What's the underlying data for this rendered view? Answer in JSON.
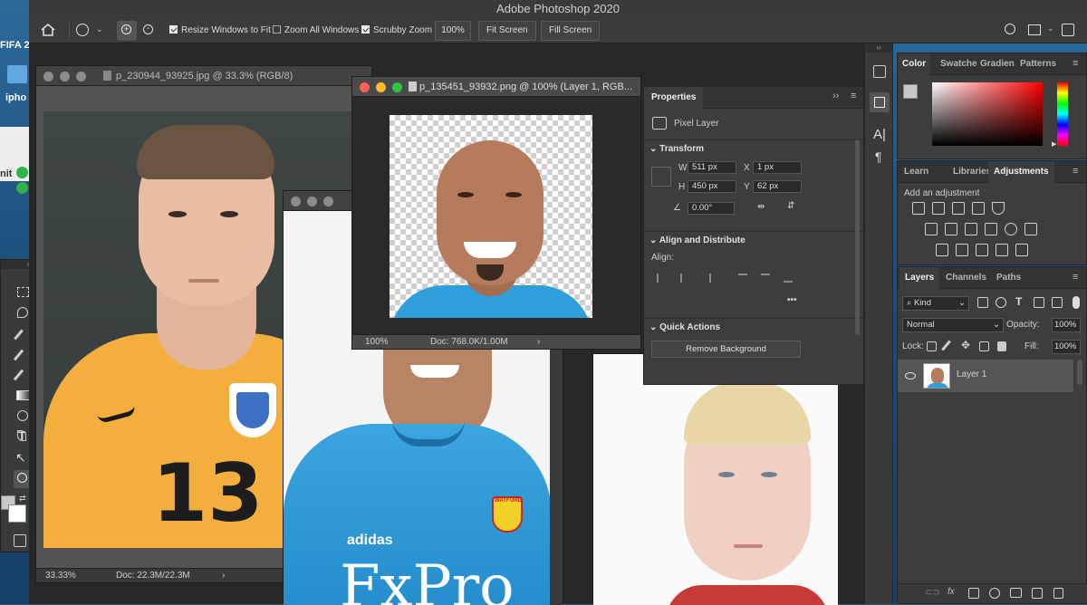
{
  "app": {
    "title": "Adobe Photoshop 2020"
  },
  "desktop": {
    "icons": [
      {
        "label": "FIFA 2"
      },
      {
        "label": "ipho"
      },
      {
        "label": "nit"
      }
    ]
  },
  "options": {
    "resize_label": "Resize Windows to Fit",
    "zoom_all_label": "Zoom All Windows",
    "scrubby_label": "Scrubby Zoom",
    "zoom_value": "100%",
    "fit_screen": "Fit Screen",
    "fill_screen": "Fill Screen"
  },
  "docs": {
    "doc1": {
      "title": "p_230944_93925.jpg @ 33.3% (RGB/8)",
      "zoom": "33.33%",
      "info": "Doc: 22.3M/22.3M",
      "arrow": "›",
      "jersey_number": "13"
    },
    "doc2": {
      "title": "p_135451_93932.png @ 100% (Layer 1, RGB...",
      "zoom": "100%",
      "info": "Doc: 768.0K/1.00M",
      "arrow": "›"
    },
    "doc3": {
      "brand": "adidas",
      "sponsor": "FxPro",
      "crest": "WATFORD"
    }
  },
  "properties": {
    "title": "Properties",
    "layer_type": "Pixel Layer",
    "transform": {
      "title": "Transform",
      "w_label": "W",
      "w": "511 px",
      "x_label": "X",
      "x": "1 px",
      "h_label": "H",
      "h": "450 px",
      "y_label": "Y",
      "y": "62 px",
      "angle": "0.00°"
    },
    "align": {
      "title": "Align and Distribute",
      "label": "Align:"
    },
    "quick": {
      "title": "Quick Actions",
      "remove_bg": "Remove Background"
    }
  },
  "color_panel": {
    "tabs": [
      "Color",
      "Swatche",
      "Gradien",
      "Patterns"
    ]
  },
  "adjust_panel": {
    "tabs": [
      "Learn",
      "Libraries",
      "Adjustments"
    ],
    "add_label": "Add an adjustment"
  },
  "layers_panel": {
    "tabs": [
      "Layers",
      "Channels",
      "Paths"
    ],
    "filter": "Kind",
    "blend": "Normal",
    "opacity_label": "Opacity:",
    "opacity": "100%",
    "lock_label": "Lock:",
    "fill_label": "Fill:",
    "fill": "100%",
    "layers": [
      {
        "name": "Layer 1"
      }
    ]
  },
  "colors": {
    "accent": "#d0d0d0",
    "workspace": "#282828",
    "panel": "#3d3d3d"
  }
}
